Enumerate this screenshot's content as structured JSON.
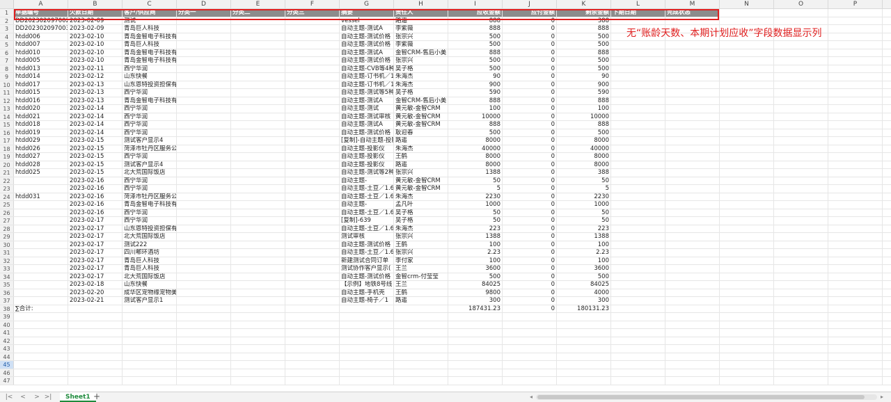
{
  "columns": [
    "A",
    "B",
    "C",
    "D",
    "E",
    "F",
    "G",
    "H",
    "I",
    "J",
    "K",
    "L",
    "M",
    "N",
    "O",
    "P"
  ],
  "header": [
    "单据编号",
    "欠款日期",
    "客户/供应商",
    "分类一",
    "分类二",
    "分类三",
    "摘要",
    "责任人",
    "应收金额",
    "应付金额",
    "剩余金额",
    "下期日期",
    "完成状态"
  ],
  "rows": [
    [
      "DD202302097002",
      "2023-02-09",
      "测试",
      "",
      "",
      "",
      "vessel",
      "路遥",
      "888",
      "0",
      "388"
    ],
    [
      "DD202302097003",
      "2023-02-09",
      "青岛巨人科技",
      "",
      "",
      "",
      "自动主题-测试A",
      "李紫薇",
      "888",
      "0",
      "888"
    ],
    [
      "htdd006",
      "2023-02-10",
      "青岛金智电子科技有",
      "",
      "",
      "",
      "自动主题-测试价格",
      "张宗兴",
      "500",
      "0",
      "500"
    ],
    [
      "htdd007",
      "2023-02-10",
      "青岛巨人科技",
      "",
      "",
      "",
      "自动主题-测试价格",
      "李紫薇",
      "500",
      "0",
      "500"
    ],
    [
      "htdd010",
      "2023-02-10",
      "青岛金智电子科技有",
      "",
      "",
      "",
      "自动主题-测试A",
      "金智CRM-售后小美",
      "888",
      "0",
      "888"
    ],
    [
      "htdd005",
      "2023-02-10",
      "青岛金智电子科技有",
      "",
      "",
      "",
      "自动主题-测试价格",
      "张宗兴",
      "500",
      "0",
      "500"
    ],
    [
      "htdd013",
      "2023-02-11",
      "西宁华润",
      "",
      "",
      "",
      "自动主题-CVB等4种",
      "吴子格",
      "500",
      "0",
      "500"
    ],
    [
      "htdd014",
      "2023-02-12",
      "山东快餐",
      "",
      "",
      "",
      "自动主题-订书机／1",
      "朱海杰",
      "90",
      "0",
      "90"
    ],
    [
      "htdd017",
      "2023-02-13",
      "山东恩特投资担保有",
      "",
      "",
      "",
      "自动主题-订书机／1",
      "朱海杰",
      "900",
      "0",
      "900"
    ],
    [
      "htdd015",
      "2023-02-13",
      "西宁华润",
      "",
      "",
      "",
      "自动主题-测试等5种",
      "吴子格",
      "590",
      "0",
      "590"
    ],
    [
      "htdd016",
      "2023-02-13",
      "青岛金智电子科技有",
      "",
      "",
      "",
      "自动主题-测试A",
      "金智CRM-售后小美",
      "888",
      "0",
      "888"
    ],
    [
      "htdd020",
      "2023-02-14",
      "西宁华润",
      "",
      "",
      "",
      "自动主题-测试",
      "黄元敏-金智CRM",
      "100",
      "0",
      "100"
    ],
    [
      "htdd021",
      "2023-02-14",
      "西宁华润",
      "",
      "",
      "",
      "自动主题-测试审核",
      "黄元敏-金智CRM",
      "10000",
      "0",
      "10000"
    ],
    [
      "htdd018",
      "2023-02-14",
      "西宁华润",
      "",
      "",
      "",
      "自动主题-测试A",
      "黄元敏-金智CRM",
      "888",
      "0",
      "888"
    ],
    [
      "htdd019",
      "2023-02-14",
      "西宁华润",
      "",
      "",
      "",
      "自动主题-测试价格",
      "耿迎春",
      "500",
      "0",
      "500"
    ],
    [
      "htdd029",
      "2023-02-15",
      "测试客户显示4",
      "",
      "",
      "",
      "[复制]-自动主题-投影",
      "路遥",
      "8000",
      "0",
      "8000"
    ],
    [
      "htdd026",
      "2023-02-15",
      "菏泽市牡丹区服务公",
      "",
      "",
      "",
      "自动主题-投影仪",
      "朱海杰",
      "40000",
      "0",
      "40000"
    ],
    [
      "htdd027",
      "2023-02-15",
      "西宁华润",
      "",
      "",
      "",
      "自动主题-投影仪",
      "王鹤",
      "8000",
      "0",
      "8000"
    ],
    [
      "htdd028",
      "2023-02-15",
      "测试客户显示4",
      "",
      "",
      "",
      "自动主题-投影仪",
      "路遥",
      "8000",
      "0",
      "8000"
    ],
    [
      "htdd025",
      "2023-02-15",
      "北大荒国际饭店",
      "",
      "",
      "",
      "自动主题-测试等2种",
      "张宗兴",
      "1388",
      "0",
      "388"
    ],
    [
      "",
      "2023-02-16",
      "西宁华润",
      "",
      "",
      "",
      "自动主题-",
      "黄元敏-金智CRM",
      "50",
      "0",
      "50"
    ],
    [
      "",
      "2023-02-16",
      "西宁华润",
      "",
      "",
      "",
      "自动主题-土豆／1.6",
      "黄元敏-金智CRM",
      "5",
      "0",
      "5"
    ],
    [
      "htdd031",
      "2023-02-16",
      "菏泽市牡丹区服务公",
      "",
      "",
      "",
      "自动主题-土豆／1.6",
      "朱海杰",
      "2230",
      "0",
      "2230"
    ],
    [
      "",
      "2023-02-16",
      "青岛金智电子科技有",
      "",
      "",
      "",
      "自动主题-",
      "孟凡叶",
      "1000",
      "0",
      "1000"
    ],
    [
      "",
      "2023-02-16",
      "西宁华润",
      "",
      "",
      "",
      "自动主题-土豆／1.6",
      "吴子格",
      "50",
      "0",
      "50"
    ],
    [
      "",
      "2023-02-17",
      "西宁华润",
      "",
      "",
      "",
      "[复制]-639",
      "吴子格",
      "50",
      "0",
      "50"
    ],
    [
      "",
      "2023-02-17",
      "山东恩特投资担保有",
      "",
      "",
      "",
      "自动主题-土豆／1.6",
      "朱海杰",
      "223",
      "0",
      "223"
    ],
    [
      "",
      "2023-02-17",
      "北大荒国际饭店",
      "",
      "",
      "",
      "测试审核",
      "张宗兴",
      "1388",
      "0",
      "1388"
    ],
    [
      "",
      "2023-02-17",
      "测试222",
      "",
      "",
      "",
      "自动主题-测试价格",
      "王鹤",
      "100",
      "0",
      "100"
    ],
    [
      "",
      "2023-02-17",
      "四川郫环酒坊",
      "",
      "",
      "",
      "自动主题-土豆／1.6",
      "张宗兴",
      "2.23",
      "0",
      "2.23"
    ],
    [
      "",
      "2023-02-17",
      "青岛巨人科技",
      "",
      "",
      "",
      "新建测试合同订单",
      "李付家",
      "100",
      "0",
      "100"
    ],
    [
      "",
      "2023-02-17",
      "青岛巨人科技",
      "",
      "",
      "",
      "测试协作客户显示(",
      "王兰",
      "3600",
      "0",
      "3600"
    ],
    [
      "",
      "2023-02-17",
      "北大荒国际饭店",
      "",
      "",
      "",
      "自动主题-测试价格",
      "金智crm-付莹莹",
      "500",
      "0",
      "500"
    ],
    [
      "",
      "2023-02-18",
      "山东快餐",
      "",
      "",
      "",
      "【示例】地铁8号线",
      "王兰",
      "84025",
      "0",
      "84025"
    ],
    [
      "",
      "2023-02-20",
      "成华区宠物缘宠物美",
      "",
      "",
      "",
      "自动主题-手机壳",
      "王鹤",
      "9800",
      "0",
      "4000"
    ],
    [
      "",
      "2023-02-21",
      "测试客户显示1",
      "",
      "",
      "",
      "自动主题-椅子／1",
      "路遥",
      "300",
      "0",
      "300"
    ],
    [
      "∑合计:",
      "",
      "",
      "",
      "",
      "",
      "",
      "",
      "187431.23",
      "0",
      "180131.23"
    ]
  ],
  "blank_rows": [
    "39",
    "40",
    "41",
    "42",
    "43",
    "44",
    "45",
    "46",
    "47"
  ],
  "selected_row": "45",
  "annotation": "无“账龄天数、本期计划应收”字段数据显示列",
  "sheet_tab": "Sheet1",
  "nav": {
    "first": "|<",
    "prev": "<",
    "next": ">",
    "last": ">|",
    "add": "+"
  },
  "colors": {
    "header_bg": "#8c8c8c",
    "highlight": "#e02020",
    "tab": "#1e8a3c"
  }
}
